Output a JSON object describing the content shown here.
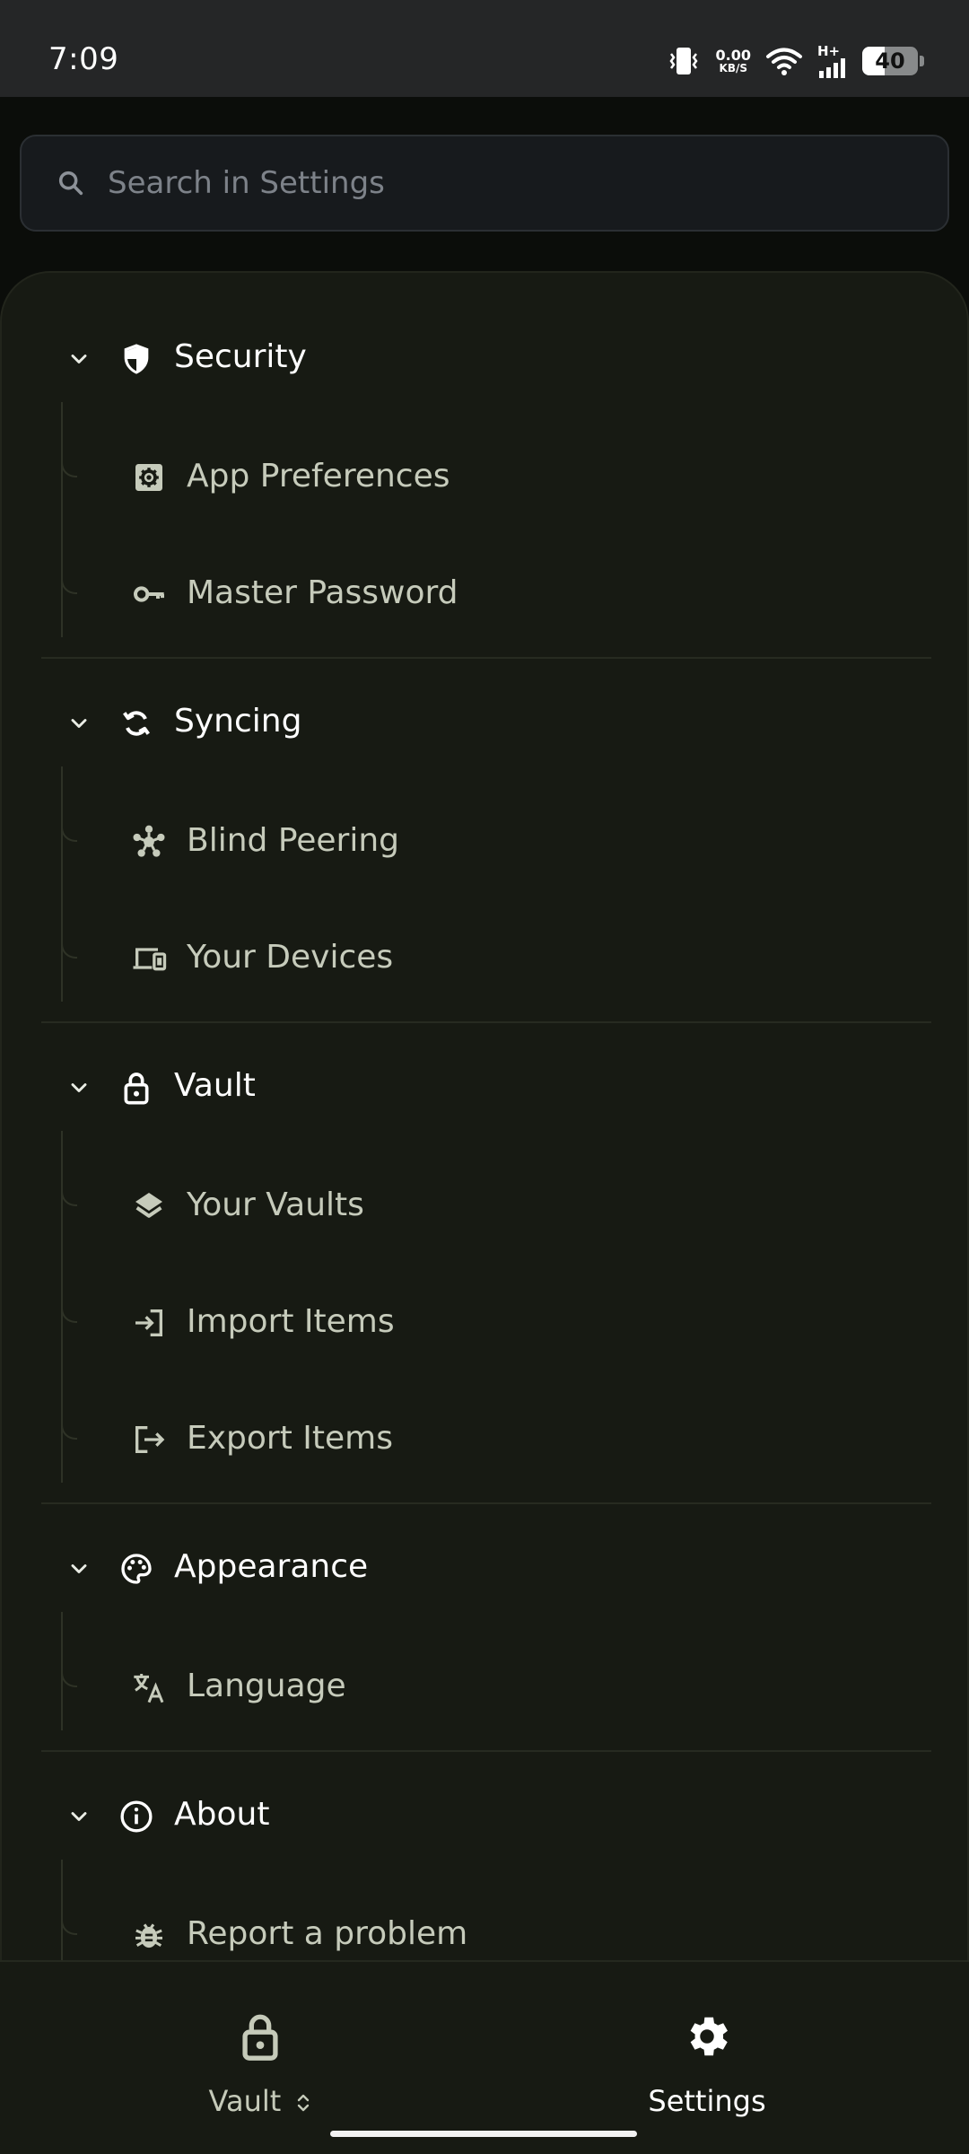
{
  "status_bar": {
    "time": "7:09",
    "net_speed_value": "0.00",
    "net_speed_unit": "KB/S",
    "network_type": "H+",
    "battery_level": "40",
    "battery_fraction": 0.4
  },
  "search": {
    "placeholder": "Search in Settings",
    "value": ""
  },
  "sections": [
    {
      "title": "Security",
      "icon": "shield-icon",
      "items": [
        {
          "label": "App Preferences",
          "icon": "gear-box-icon"
        },
        {
          "label": "Master Password",
          "icon": "key-icon"
        }
      ]
    },
    {
      "title": "Syncing",
      "icon": "sync-icon",
      "items": [
        {
          "label": "Blind Peering",
          "icon": "network-hub-icon"
        },
        {
          "label": "Your Devices",
          "icon": "devices-icon"
        }
      ]
    },
    {
      "title": "Vault",
      "icon": "lock-icon",
      "items": [
        {
          "label": "Your Vaults",
          "icon": "layers-icon"
        },
        {
          "label": "Import Items",
          "icon": "import-icon"
        },
        {
          "label": "Export Items",
          "icon": "export-icon"
        }
      ]
    },
    {
      "title": "Appearance",
      "icon": "palette-icon",
      "items": [
        {
          "label": "Language",
          "icon": "translate-icon"
        }
      ]
    },
    {
      "title": "About",
      "icon": "info-icon",
      "items": [
        {
          "label": "Report a problem",
          "icon": "bug-icon"
        }
      ]
    }
  ],
  "bottom_nav": {
    "vault_label": "Vault",
    "settings_label": "Settings",
    "active": "Settings"
  },
  "colors": {
    "background": "#0b0d0a",
    "panel": "#171a13",
    "item_text": "#c6cbbb",
    "header_text": "#ffffff"
  }
}
